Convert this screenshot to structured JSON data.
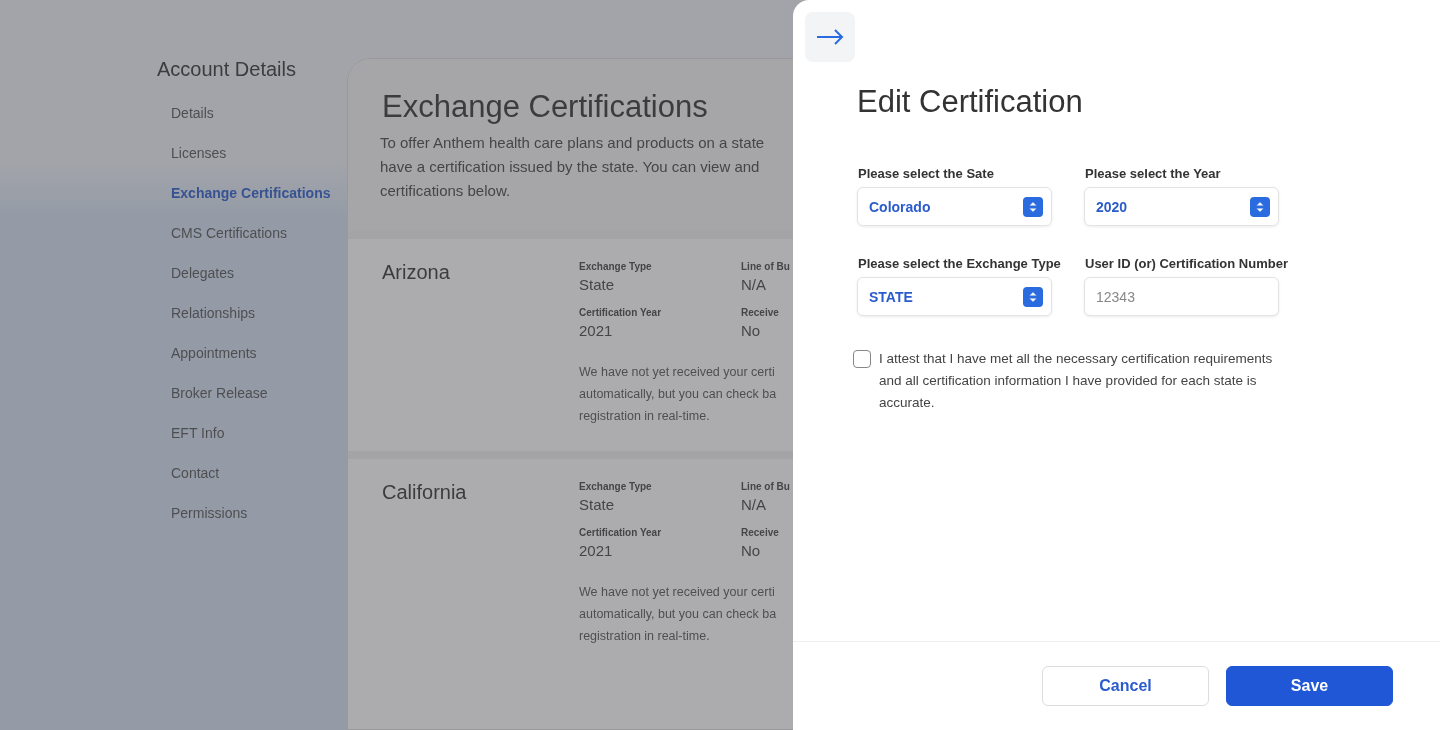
{
  "sidebar": {
    "title": "Account Details",
    "items": [
      {
        "label": "Details",
        "selected": false
      },
      {
        "label": "Licenses",
        "selected": false
      },
      {
        "label": "Exchange Certifications",
        "selected": true
      },
      {
        "label": "CMS Certifications",
        "selected": false
      },
      {
        "label": "Delegates",
        "selected": false
      },
      {
        "label": "Relationships",
        "selected": false
      },
      {
        "label": "Appointments",
        "selected": false
      },
      {
        "label": "Broker Release",
        "selected": false
      },
      {
        "label": "EFT Info",
        "selected": false
      },
      {
        "label": "Contact",
        "selected": false
      },
      {
        "label": "Permissions",
        "selected": false
      }
    ]
  },
  "main": {
    "title": "Exchange Certifications",
    "intro_lines": [
      "To offer Anthem health care plans and products on a state",
      "have a certification issued by the state. You can view and",
      "certifications below."
    ],
    "certifications": [
      {
        "state": "Arizona",
        "fields": [
          {
            "label": "Exchange Type",
            "value": "State"
          },
          {
            "label": "Line of Bu",
            "value": "N/A"
          },
          {
            "label": "Certification Year",
            "value": "2021"
          },
          {
            "label": "Receive",
            "value": "No"
          }
        ],
        "message_lines": [
          "We have not yet received your certi",
          "automatically, but you can check ba",
          "registration in real-time."
        ]
      },
      {
        "state": "California",
        "fields": [
          {
            "label": "Exchange Type",
            "value": "State"
          },
          {
            "label": "Line of Bu",
            "value": "N/A"
          },
          {
            "label": "Certification Year",
            "value": "2021"
          },
          {
            "label": "Receive",
            "value": "No"
          }
        ],
        "message_lines": [
          "We have not yet received your certi",
          "automatically, but you can check ba",
          "registration in real-time."
        ]
      }
    ]
  },
  "drawer": {
    "title": "Edit Certification",
    "fields": [
      {
        "kind": "select",
        "label": "Please select the Sate",
        "value": "Colorado"
      },
      {
        "kind": "select",
        "label": "Please select the Year",
        "value": "2020"
      },
      {
        "kind": "select",
        "label": "Please select the Exchange Type",
        "value": "STATE"
      },
      {
        "kind": "input",
        "label": "User ID (or) Certification Number",
        "placeholder": "12343"
      }
    ],
    "attest": {
      "label": "I attest that I have met all the necessary certification requirements and all certification information I have provided for each state is accurate.",
      "checked": false
    },
    "buttons": [
      {
        "kind": "secondary",
        "label": "Cancel"
      },
      {
        "kind": "primary",
        "label": "Save"
      }
    ]
  }
}
